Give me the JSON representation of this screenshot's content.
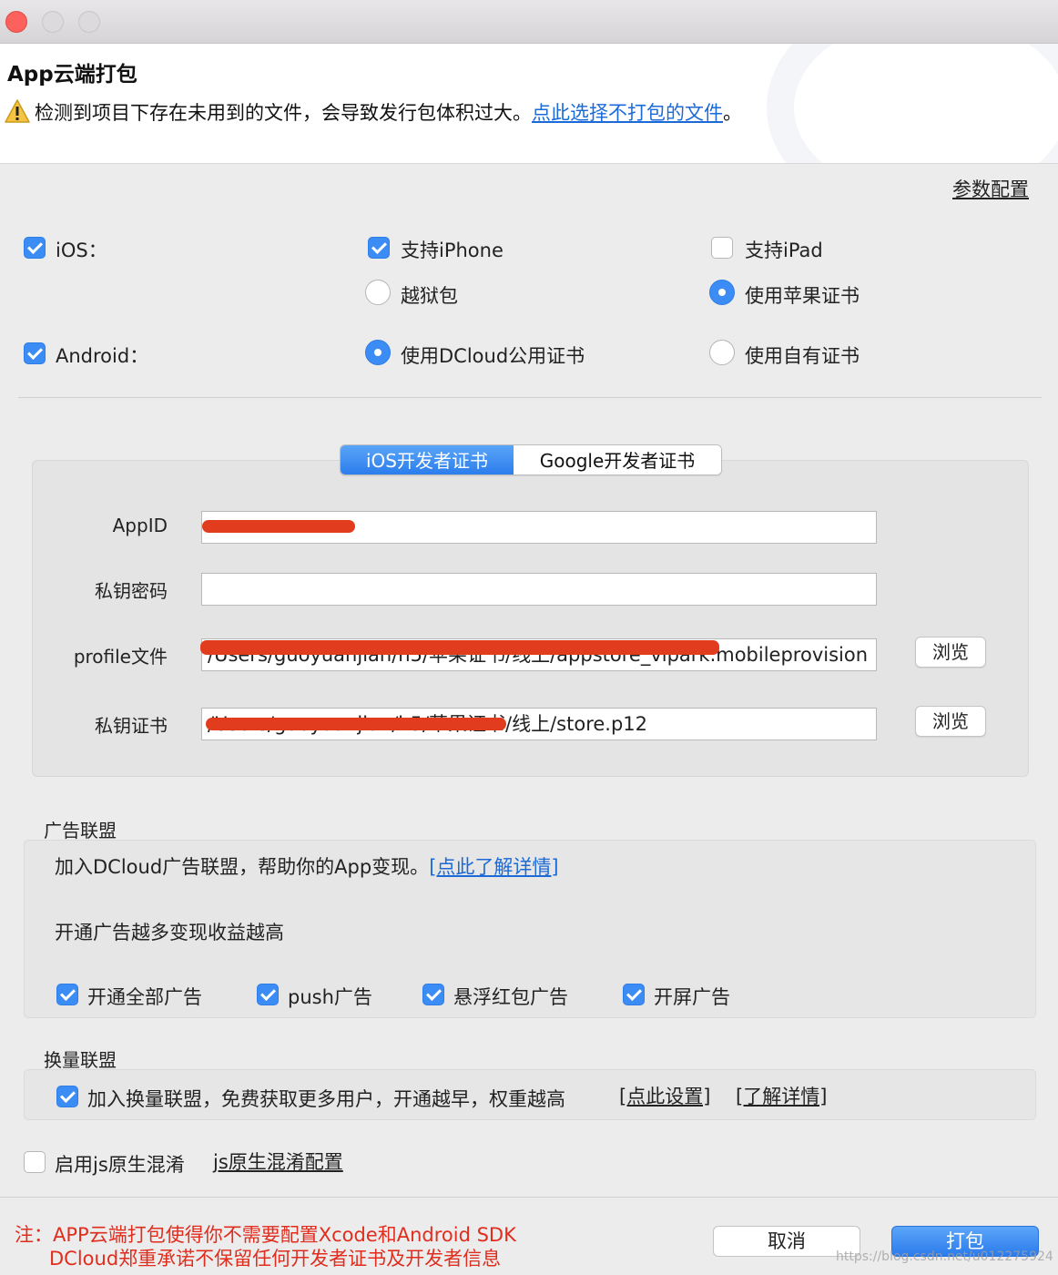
{
  "window": {
    "title": "App云端打包",
    "warning": {
      "icon": "warning-icon",
      "text": "检测到项目下存在未用到的文件，会导致发行包体积过大。",
      "link": "点此选择不打包的文件",
      "suffix": "。"
    },
    "param_link": "参数配置"
  },
  "platforms": {
    "ios": {
      "label": "iOS：",
      "checked": true
    },
    "support_iphone": {
      "label": "支持iPhone",
      "checked": true
    },
    "support_ipad": {
      "label": "支持iPad",
      "checked": false
    },
    "jailbreak": {
      "label": "越狱包",
      "checked": false
    },
    "apple_cert": {
      "label": "使用苹果证书",
      "checked": true
    },
    "android": {
      "label": "Android：",
      "checked": true
    },
    "dcloud_cert": {
      "label": "使用DCloud公用证书",
      "checked": true
    },
    "own_cert": {
      "label": "使用自有证书",
      "checked": false
    }
  },
  "cert_tabs": {
    "ios_label": "iOS开发者证书",
    "google_label": "Google开发者证书",
    "active": "ios"
  },
  "cert_form": {
    "appid_label": "AppID",
    "appid_value": "",
    "password_label": "私钥密码",
    "password_value": "",
    "profile_label": "profile文件",
    "profile_value": "/Users/guoyuanjian/h5/苹果证书/线上/appstore_vipark.mobileprovision",
    "privkey_label": "私钥证书",
    "privkey_value": "/Users/guoyuanjian/h5/苹果证书/线上/store.p12",
    "browse_label": "浏览"
  },
  "ads": {
    "title": "广告联盟",
    "intro": "加入DCloud广告联盟，帮助你的App变现。",
    "intro_link": "[点此了解详情]",
    "subtitle": "开通广告越多变现收益越高",
    "options": [
      {
        "label": "开通全部广告",
        "checked": true
      },
      {
        "label": "push广告",
        "checked": true
      },
      {
        "label": "悬浮红包广告",
        "checked": true
      },
      {
        "label": "开屏广告",
        "checked": true
      }
    ]
  },
  "exchange": {
    "title": "换量联盟",
    "label": "加入换量联盟，免费获取更多用户，开通越早，权重越高",
    "checked": true,
    "link_setup": "[点此设置]",
    "link_details": "[了解详情]"
  },
  "js_obfuscation": {
    "label": "启用js原生混淆",
    "checked": false,
    "link": "js原生混淆配置"
  },
  "footer": {
    "note_line1": "注：APP云端打包使得你不需要配置Xcode和Android SDK",
    "note_line2": "DCloud郑重承诺不保留任何开发者证书及开发者信息",
    "cancel_label": "取消",
    "build_label": "打包",
    "watermark": "https://blog.csdn.net/u012275924"
  },
  "colors": {
    "accent": "#3b8cf5",
    "link": "#1b6ad8",
    "note_red": "#e02d1e"
  }
}
